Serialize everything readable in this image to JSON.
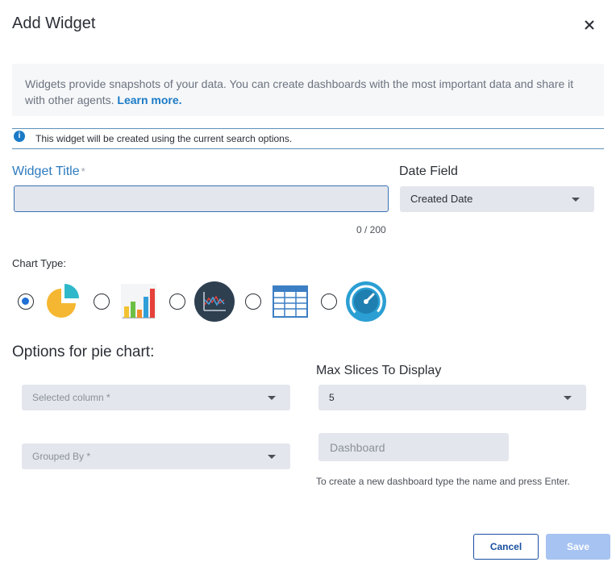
{
  "dialog": {
    "title": "Add Widget",
    "close_icon": "close-icon"
  },
  "info": {
    "text": "Widgets provide snapshots of your data. You can create dashboards with the most important data and share it with other agents. ",
    "link": "Learn more."
  },
  "notice": {
    "icon": "info-icon",
    "text": "This widget will be created using the current search options."
  },
  "widget_title": {
    "label": "Widget Title",
    "required_mark": "*",
    "value": "",
    "char_count": "0 / 200"
  },
  "date_field": {
    "label": "Date Field",
    "selected": "Created Date"
  },
  "chart_type": {
    "label": "Chart Type:",
    "selected": "pie",
    "options": [
      {
        "name": "pie",
        "icon": "pie-chart-icon"
      },
      {
        "name": "bar",
        "icon": "bar-chart-icon"
      },
      {
        "name": "line",
        "icon": "line-chart-icon"
      },
      {
        "name": "table",
        "icon": "table-icon"
      },
      {
        "name": "gauge",
        "icon": "gauge-icon"
      }
    ]
  },
  "pie_options": {
    "heading": "Options for pie chart:",
    "selected_column_placeholder": "Selected column *",
    "grouped_by_placeholder": "Grouped By *",
    "max_slices_label": "Max Slices To Display",
    "max_slices_value": "5",
    "dashboard_placeholder": "Dashboard",
    "dashboard_hint": "To create a new dashboard type the name and press Enter."
  },
  "buttons": {
    "cancel": "Cancel",
    "save": "Save"
  },
  "colors": {
    "accent": "#1a7ac7",
    "primary_button": "#1a4fa0",
    "save_disabled": "#a6c3f1",
    "input_bg": "#e3e6ec"
  }
}
